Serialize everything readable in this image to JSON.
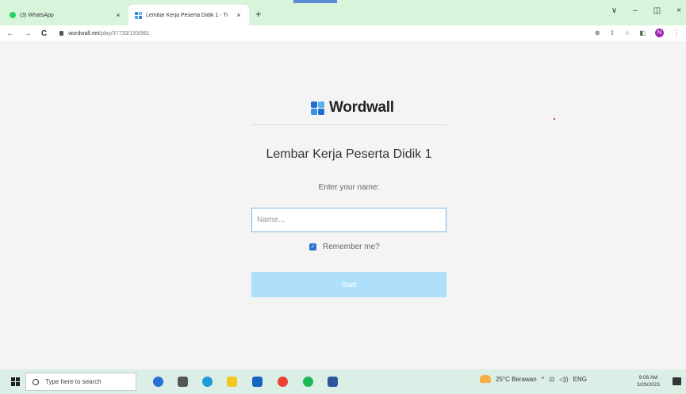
{
  "browser": {
    "tabs": [
      {
        "title": "(3) WhatsApp",
        "close": "×"
      },
      {
        "title": "Lembar Kerja Peserta Didik 1 - Ti",
        "close": "×"
      }
    ],
    "new_tab": "+",
    "window_controls": [
      "∨",
      "–",
      "◫",
      "×"
    ],
    "nav": {
      "back": "←",
      "forward": "→",
      "reload": "C"
    },
    "url_host": "wordwall.net",
    "url_path": "/play/37733/193/981"
  },
  "page": {
    "logo_text": "Wordwall",
    "activity_title": "Lembar Kerja Peserta Didik 1",
    "prompt": "Enter your name:",
    "name_input": {
      "placeholder": "Name...",
      "value": ""
    },
    "remember_label": "Remember me?",
    "remember_checked": true,
    "start_label": "Start"
  },
  "taskbar": {
    "search_placeholder": "Type here to search",
    "weather": "25°C  Berawan",
    "language": "ENG",
    "time": "9:06 AM",
    "date": "3/29/2023"
  },
  "colors": {
    "tabstrip_bg": "#d8f5dc",
    "page_bg": "#f4f4f4",
    "input_border": "#7ab8e6",
    "start_button": "#aee0fb",
    "checkbox": "#2c6fcf",
    "taskbar_bg": "#dcefe6"
  }
}
